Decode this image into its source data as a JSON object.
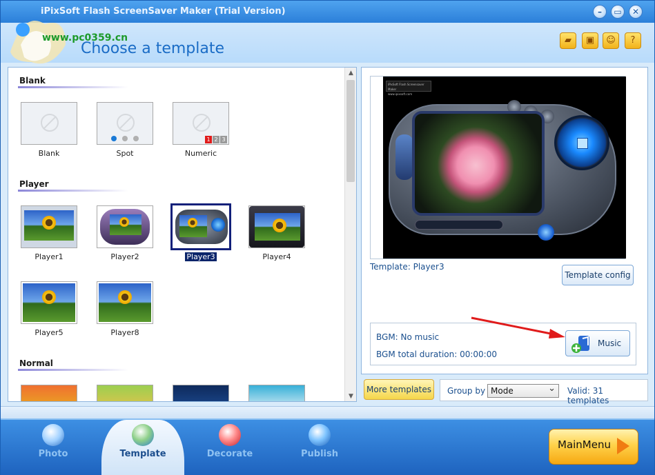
{
  "window": {
    "title": "iPixSoft Flash ScreenSaver Maker (Trial Version)",
    "minimize_glyph": "–",
    "maximize_glyph": "▭",
    "close_glyph": "✕"
  },
  "header": {
    "site_watermark": "www.pc0359.cn",
    "page_title": "Choose a template",
    "icons": [
      "folder-icon",
      "save-icon",
      "user-icon",
      "help-icon"
    ],
    "icon_glyphs": [
      "▰",
      "▣",
      "☺",
      "?"
    ]
  },
  "templates": {
    "sections": [
      {
        "name": "Blank",
        "items": [
          "Blank",
          "Spot",
          "Numeric"
        ]
      },
      {
        "name": "Player",
        "items": [
          "Player1",
          "Player2",
          "Player3",
          "Player4",
          "Player5",
          "Player8"
        ]
      },
      {
        "name": "Normal",
        "items": []
      }
    ],
    "selected": "Player3",
    "numeric_badges": [
      "1",
      "2",
      "3"
    ]
  },
  "preview": {
    "mini_title": "iPixSoft Flash Screensaver Maker",
    "mini_url": "www.ipixsoft.com",
    "template_label": "Template:  Player3",
    "template_config_label": "Template config"
  },
  "bgm": {
    "name_label": "BGM: No music",
    "duration_label": "BGM total duration: 00:00:00",
    "music_button_label": "Music"
  },
  "controls": {
    "more_templates_label": "More templates",
    "group_by_label": "Group by",
    "group_by_value": "Mode",
    "valid_text": "Valid: 31 templates"
  },
  "nav": {
    "tabs": [
      "Photo",
      "Template",
      "Decorate",
      "Publish"
    ],
    "active": "Template",
    "main_menu_label": "MainMenu"
  },
  "colors": {
    "accent": "#2b7fd9",
    "selection": "#0a246a",
    "arrow": "#e01b1b"
  }
}
